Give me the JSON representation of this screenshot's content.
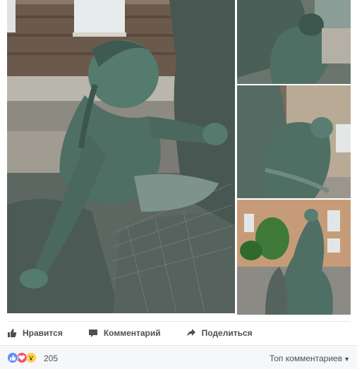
{
  "photos": [
    {
      "alt": "main-statue-photo"
    },
    {
      "alt": "thumbnail-1"
    },
    {
      "alt": "thumbnail-2"
    },
    {
      "alt": "thumbnail-3"
    }
  ],
  "actions": {
    "like_label": "Нравится",
    "comment_label": "Комментарий",
    "share_label": "Поделиться"
  },
  "reactions": {
    "icons": [
      "like-icon",
      "love-icon",
      "wow-icon"
    ],
    "count": "205",
    "sort_label": "Топ комментариев"
  },
  "colors": {
    "like": "#5890ff",
    "love": "#f25268",
    "wow": "#fcd34d",
    "bronze": "#4f6f64"
  }
}
